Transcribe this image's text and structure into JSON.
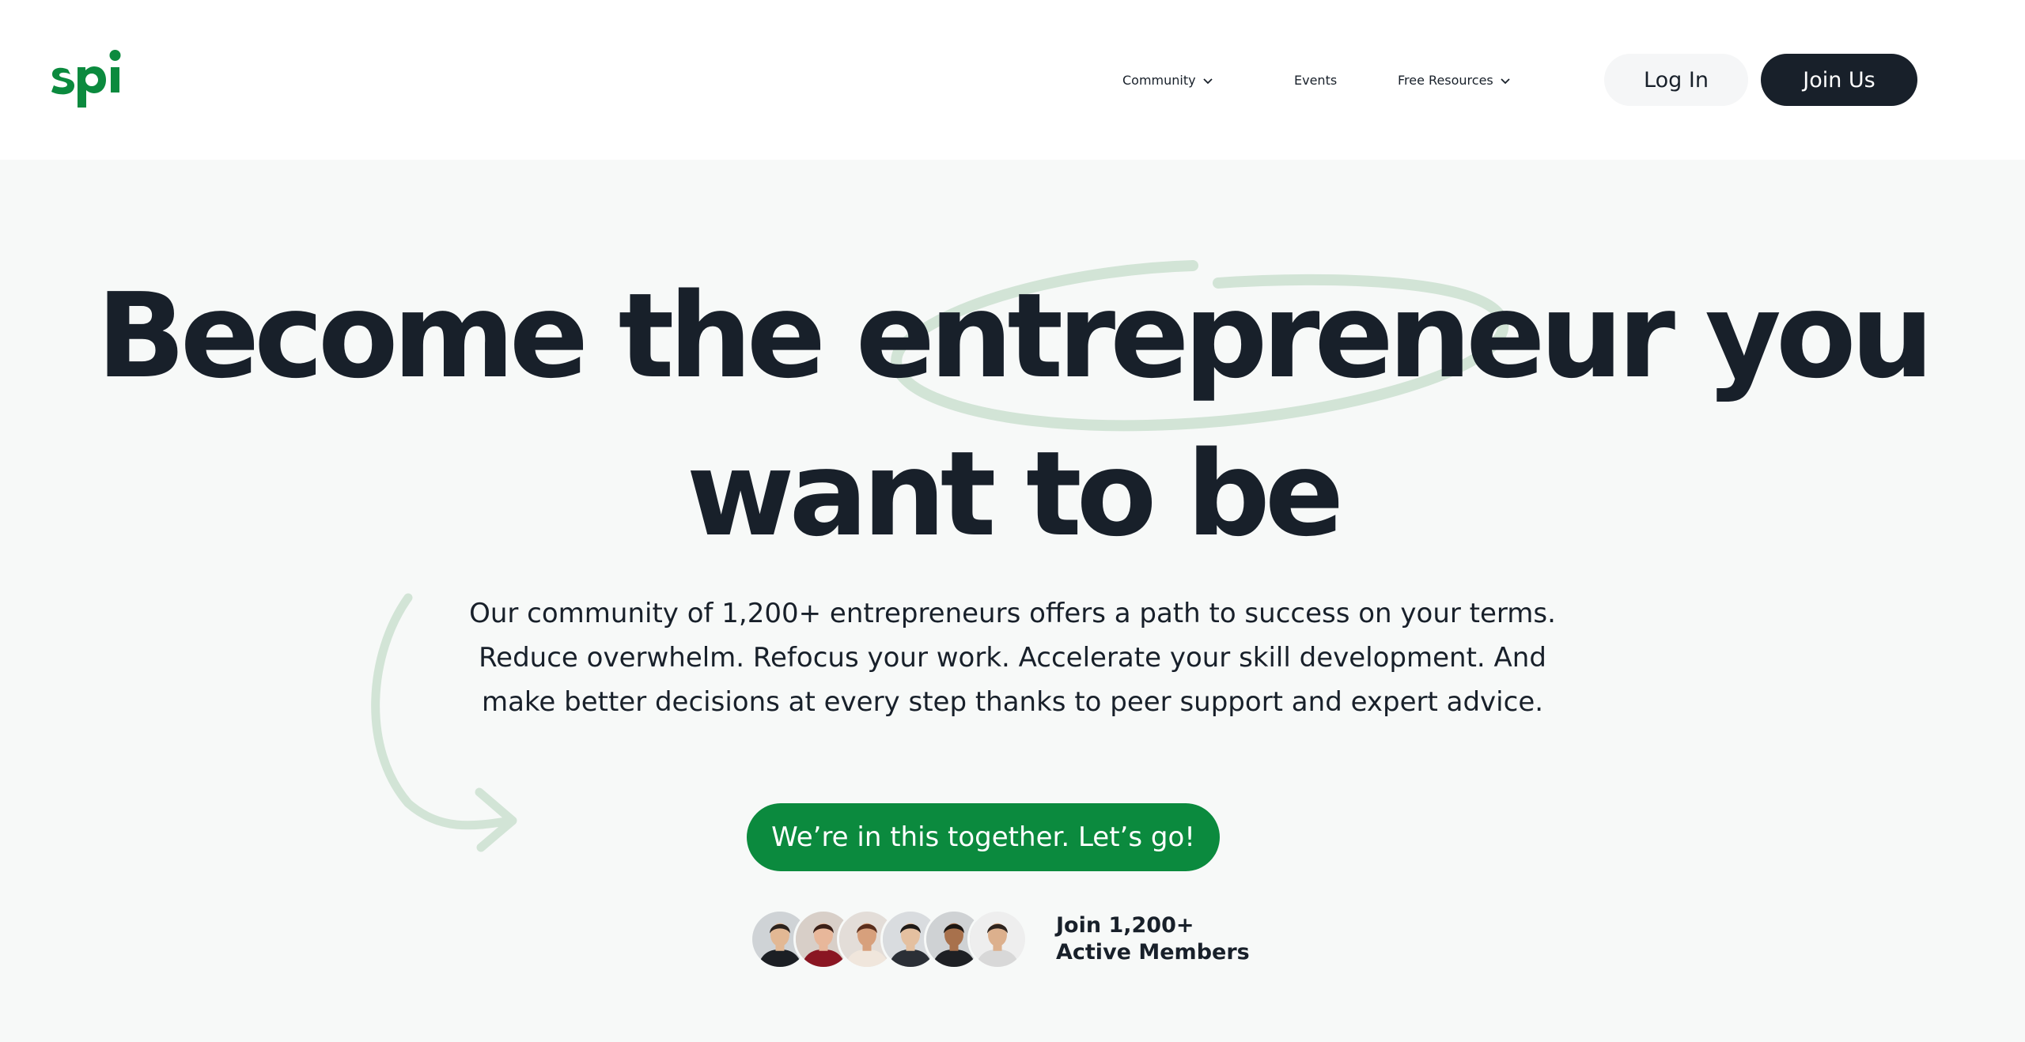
{
  "brand": {
    "logo_text": "spi",
    "accent_color": "#0b8a3e",
    "dark_color": "#18202a"
  },
  "nav": {
    "items": [
      {
        "label": "Community",
        "has_dropdown": true
      },
      {
        "label": "Events",
        "has_dropdown": false
      },
      {
        "label": "Free Resources",
        "has_dropdown": true
      }
    ],
    "login_label": "Log In",
    "join_label": "Join Us"
  },
  "hero": {
    "headline_line1": "Become the entrepreneur you",
    "headline_line2": "want to be",
    "subtext_lines": [
      "Our community of 1,200+ entrepreneurs offers a path to success on your terms.",
      "Reduce overwhelm. Refocus your work. Accelerate your skill development. And",
      "make better decisions at every step thanks to peer support and expert advice."
    ],
    "cta_label": "We’re in this together. Let’s go!",
    "members_line1": "Join 1,200+",
    "members_line2": "Active Members",
    "avatars": [
      {
        "name": "member-avatar-1",
        "bg": "#cfd3d6",
        "skin": "#e2b894",
        "hair": "#2a221d",
        "shirt": "#1c1f24"
      },
      {
        "name": "member-avatar-2",
        "bg": "#d8cfc8",
        "skin": "#e8b79a",
        "hair": "#3a1f17",
        "shirt": "#8a1622"
      },
      {
        "name": "member-avatar-3",
        "bg": "#e3ddd8",
        "skin": "#d7a07c",
        "hair": "#5a2e1c",
        "shirt": "#f0e6dc"
      },
      {
        "name": "member-avatar-4",
        "bg": "#d9dcdf",
        "skin": "#e4c0a0",
        "hair": "#1e1a18",
        "shirt": "#2b2f36"
      },
      {
        "name": "member-avatar-5",
        "bg": "#cfd2d4",
        "skin": "#a8714c",
        "hair": "#1b1613",
        "shirt": "#1e2024"
      },
      {
        "name": "member-avatar-6",
        "bg": "#eeeeee",
        "skin": "#dcb08d",
        "hair": "#2e241e",
        "shirt": "#d8d8d8"
      }
    ]
  }
}
